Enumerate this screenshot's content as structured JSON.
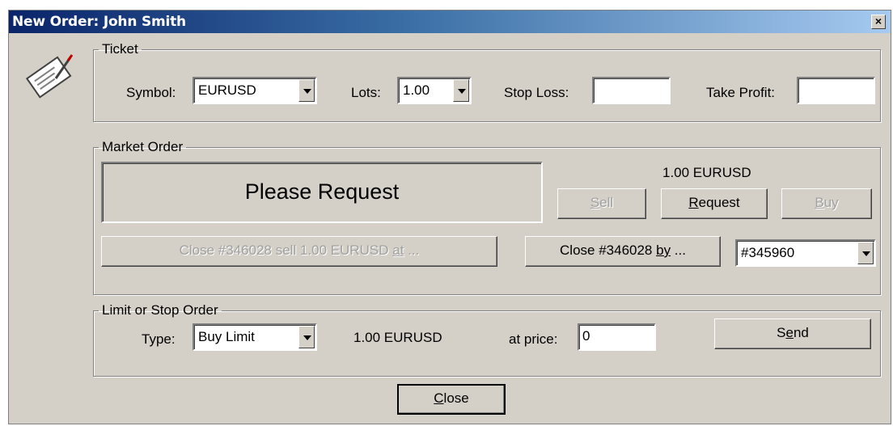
{
  "window": {
    "title": "New Order: John Smith",
    "close_glyph": "×"
  },
  "icon": "order-ticket-icon",
  "ticket": {
    "legend": "Ticket",
    "symbol_label": "Symbol:",
    "symbol_value": "EURUSD",
    "lots_label": "Lots:",
    "lots_value": "1.00",
    "stop_loss_label": "Stop Loss:",
    "stop_loss_value": "",
    "take_profit_label": "Take Profit:",
    "take_profit_value": ""
  },
  "market": {
    "legend": "Market Order",
    "status_text": "Please Request",
    "volume_text": "1.00 EURUSD",
    "sell": {
      "pre": "",
      "u": "S",
      "post": "ell"
    },
    "request": {
      "pre": "",
      "u": "R",
      "post": "equest"
    },
    "buy": {
      "pre": "",
      "u": "B",
      "post": "uy"
    },
    "close_at": {
      "pre": "Close #346028 sell 1.00 EURUSD ",
      "u": "at",
      "post": " ..."
    },
    "close_by": {
      "pre": "Close #346028 ",
      "u": "by",
      "post": " ..."
    },
    "order_select_value": "#345960"
  },
  "pending": {
    "legend": "Limit or Stop Order",
    "type_label": "Type:",
    "type_value": "Buy Limit",
    "volume_text": "1.00 EURUSD",
    "price_label": "at price:",
    "price_value": "0",
    "send": {
      "pre": "S",
      "u": "e",
      "post": "nd"
    }
  },
  "close_button": {
    "pre": "",
    "u": "C",
    "post": "lose"
  }
}
